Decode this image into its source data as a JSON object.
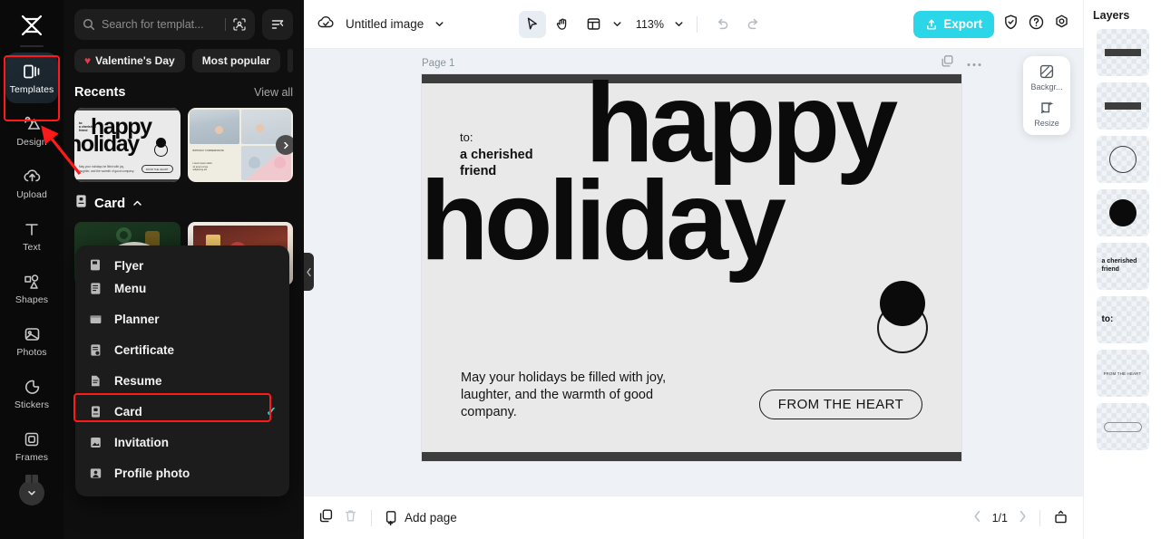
{
  "app": {
    "brand_icon": "capcut-logo-icon",
    "accent_color": "#2ad6e8",
    "highlight_color": "#ff1a1a"
  },
  "rail": {
    "items": [
      {
        "label": "Templates",
        "icon": "templates-icon",
        "active": true
      },
      {
        "label": "Design",
        "icon": "design-icon",
        "active": false
      },
      {
        "label": "Upload",
        "icon": "upload-icon",
        "active": false
      },
      {
        "label": "Text",
        "icon": "text-icon",
        "active": false
      },
      {
        "label": "Shapes",
        "icon": "shapes-icon",
        "active": false
      },
      {
        "label": "Photos",
        "icon": "photos-icon",
        "active": false
      },
      {
        "label": "Stickers",
        "icon": "stickers-icon",
        "active": false
      },
      {
        "label": "Frames",
        "icon": "frames-icon",
        "active": false
      }
    ],
    "more_icon": "chevron-down-icon"
  },
  "panel": {
    "search": {
      "placeholder": "Search for templat...",
      "search_icon": "search-icon",
      "visual_search_icon": "image-search-icon"
    },
    "filter_icon": "filter-icon",
    "chips": [
      {
        "label": "Valentine's Day",
        "icon": "heart-icon"
      },
      {
        "label": "Most popular",
        "icon": ""
      }
    ],
    "recents": {
      "title": "Recents",
      "view_all": "View all",
      "next_icon": "chevron-right-icon",
      "cards": [
        {
          "name": "happy-holiday-card",
          "to_label": "to:",
          "to_name": "a cherished friend",
          "headline_1": "happy",
          "headline_2": "holiday",
          "body": "May your holidays be filled with joy, laughter, and the warmth of good company.",
          "pill": "FROM THE HEART"
        },
        {
          "name": "birthday-collage-card",
          "caption": "BIRTHDAY COMMEMORATE"
        }
      ]
    },
    "category": {
      "label": "Card",
      "icon": "card-icon",
      "chevron": "chevron-up-icon"
    },
    "dropdown": {
      "items": [
        {
          "label": "Flyer",
          "icon": "flyer-icon",
          "selected": false
        },
        {
          "label": "Menu",
          "icon": "menu-doc-icon",
          "selected": false
        },
        {
          "label": "Planner",
          "icon": "planner-icon",
          "selected": false
        },
        {
          "label": "Certificate",
          "icon": "certificate-icon",
          "selected": false
        },
        {
          "label": "Resume",
          "icon": "resume-icon",
          "selected": false
        },
        {
          "label": "Card",
          "icon": "card-icon",
          "selected": true
        },
        {
          "label": "Invitation",
          "icon": "invitation-icon",
          "selected": false
        },
        {
          "label": "Profile photo",
          "icon": "profile-photo-icon",
          "selected": false
        }
      ],
      "check_icon": "check-icon",
      "check_color": "#2ad4d4"
    },
    "collapse_icon": "chevron-left-icon"
  },
  "topbar": {
    "cloud_icon": "cloud-saved-icon",
    "doc_title": "Untitled image",
    "title_chevron": "chevron-down-icon",
    "tools": [
      {
        "name": "select-tool",
        "icon": "cursor-icon",
        "selected": true
      },
      {
        "name": "hand-tool",
        "icon": "hand-icon",
        "selected": false
      },
      {
        "name": "layout-tool",
        "icon": "layout-icon",
        "selected": false
      }
    ],
    "layout_chevron": "chevron-down-icon",
    "zoom": "113%",
    "zoom_chevron": "chevron-down-icon",
    "undo_icon": "undo-icon",
    "redo_icon": "redo-icon",
    "export_label": "Export",
    "export_icon": "export-upload-icon",
    "shield_icon": "shield-check-icon",
    "help_icon": "question-circle-icon",
    "settings_icon": "gear-icon"
  },
  "canvas": {
    "page_label": "Page 1",
    "duplicate_icon": "duplicate-page-icon",
    "more_icon": "more-dots-icon",
    "artwork": {
      "to_label": "to:",
      "to_name": "a cherished friend",
      "headline_1": "happy",
      "headline_2": "holiday",
      "body": "May your holidays be filled with joy, laughter, and the warmth of good company.",
      "pill": "FROM THE HEART"
    },
    "float_panel": [
      {
        "label": "Backgr...",
        "icon": "background-icon"
      },
      {
        "label": "Resize",
        "icon": "resize-icon"
      }
    ]
  },
  "bottombar": {
    "duplicate_icon": "duplicate-icon",
    "delete_icon": "trash-icon",
    "add_page_label": "Add page",
    "add_page_icon": "add-page-icon",
    "prev_icon": "chevron-left-icon",
    "page_counter": "1/1",
    "next_icon": "chevron-right-icon",
    "present_icon": "present-icon"
  },
  "layers": {
    "title": "Layers",
    "items": [
      {
        "name": "layer-bar-top",
        "kind": "bar"
      },
      {
        "name": "layer-bar-bottom",
        "kind": "bar"
      },
      {
        "name": "layer-circle-outline",
        "kind": "ring"
      },
      {
        "name": "layer-circle-filled",
        "kind": "dot"
      },
      {
        "name": "layer-text-recipient",
        "kind": "text",
        "text": "a cherished friend"
      },
      {
        "name": "layer-text-to",
        "kind": "text-big",
        "text": "to:"
      },
      {
        "name": "layer-text-from-the-heart",
        "kind": "text-tiny",
        "text": "FROM THE HEART"
      },
      {
        "name": "layer-pill-shape",
        "kind": "pill"
      }
    ]
  }
}
